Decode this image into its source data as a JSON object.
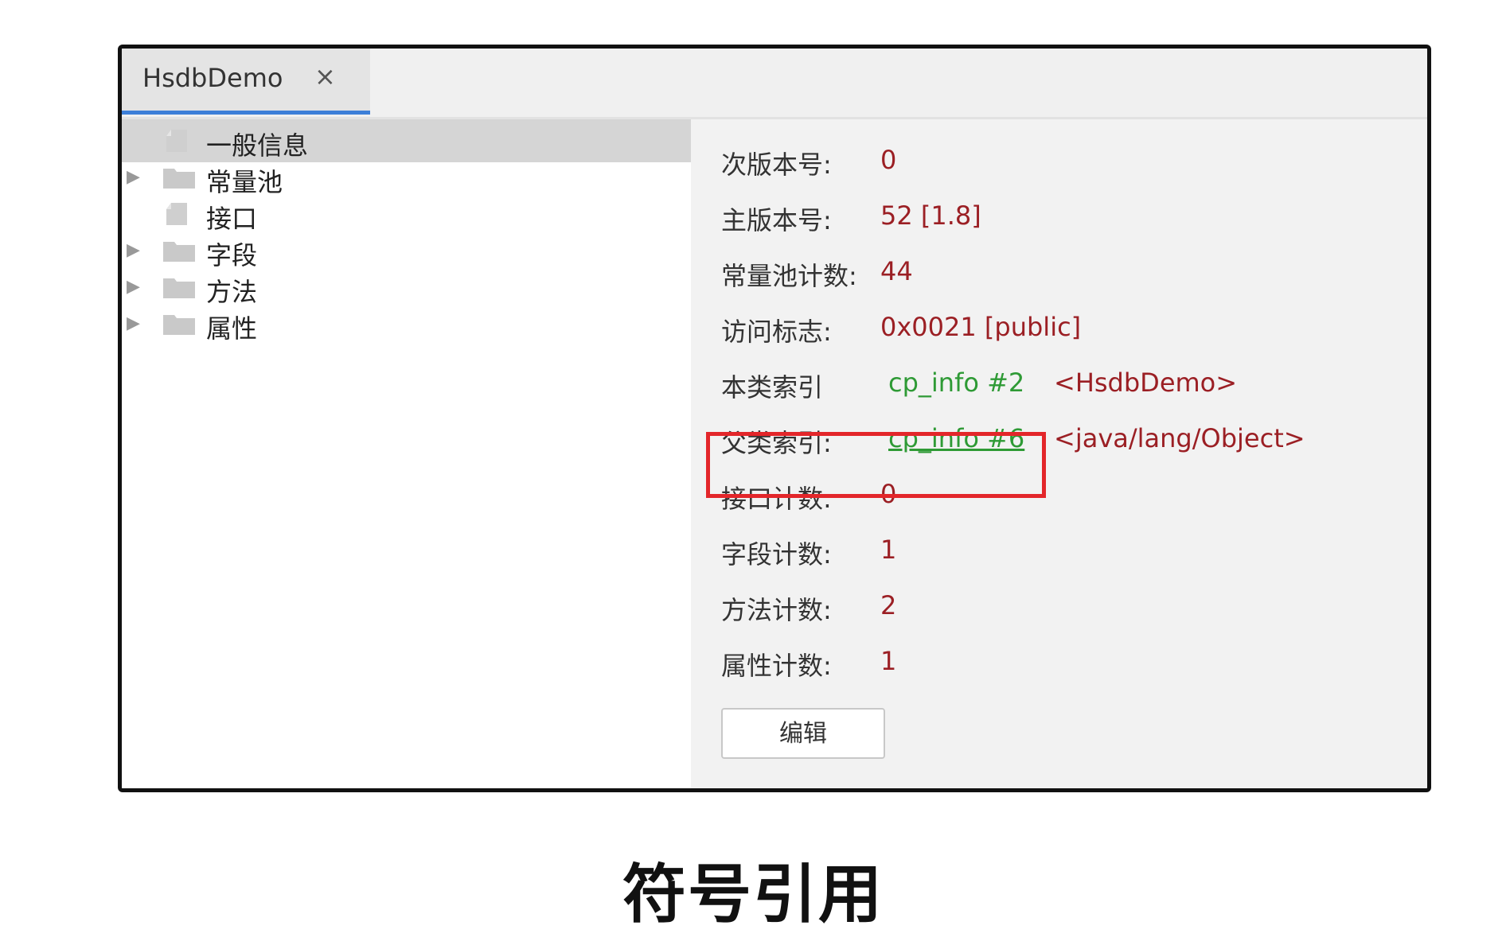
{
  "tab": {
    "title": "HsdbDemo",
    "close": "×"
  },
  "tree": [
    {
      "label": "一般信息",
      "icon": "file-icon",
      "expandable": false,
      "selected": true
    },
    {
      "label": "常量池",
      "icon": "folder-icon",
      "expandable": true,
      "selected": false
    },
    {
      "label": "接口",
      "icon": "file-icon",
      "expandable": false,
      "selected": false
    },
    {
      "label": "字段",
      "icon": "folder-icon",
      "expandable": true,
      "selected": false
    },
    {
      "label": "方法",
      "icon": "folder-icon",
      "expandable": true,
      "selected": false
    },
    {
      "label": "属性",
      "icon": "folder-icon",
      "expandable": true,
      "selected": false
    }
  ],
  "tree_arrow": "▶",
  "details": {
    "minor_version": {
      "label": "次版本号:",
      "value": "0"
    },
    "major_version": {
      "label": "主版本号:",
      "value": "52 [1.8]"
    },
    "constant_pool_count": {
      "label": "常量池计数:",
      "value": "44"
    },
    "access_flags": {
      "label": "访问标志:",
      "value": "0x0021 [public]"
    },
    "this_class": {
      "label": "本类索引",
      "link": "cp_info #2",
      "class_name": "<HsdbDemo>"
    },
    "super_class": {
      "label": "父类索引:",
      "link": "cp_info #6",
      "class_name": "<java/lang/Object>"
    },
    "interfaces_count": {
      "label": "接口计数:",
      "value": "0"
    },
    "fields_count": {
      "label": "字段计数:",
      "value": "1"
    },
    "methods_count": {
      "label": "方法计数:",
      "value": "2"
    },
    "attributes_count": {
      "label": "属性计数:",
      "value": "1"
    },
    "edit_button": "编辑"
  },
  "caption": "符号引用",
  "colors": {
    "value_red": "#9b1f24",
    "link_green": "#2e9a35",
    "highlight_red": "#e3262a",
    "tab_accent": "#3d7fd8"
  }
}
